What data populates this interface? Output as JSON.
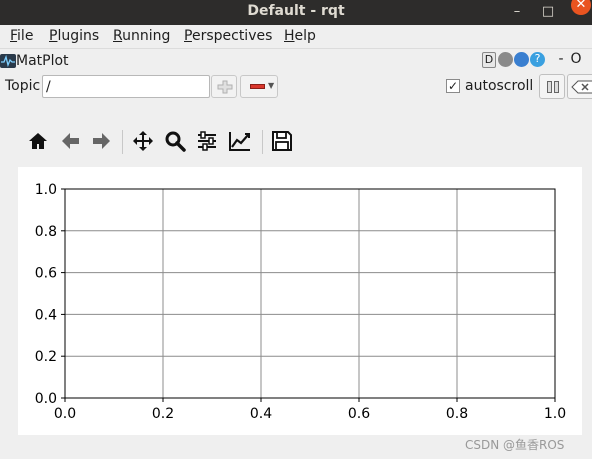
{
  "window": {
    "title": "Default - rqt",
    "minimize": "–",
    "maximize": "□",
    "close": "✕"
  },
  "menu": [
    {
      "u": "F",
      "rest": "ile"
    },
    {
      "u": "P",
      "rest": "lugins"
    },
    {
      "u": "R",
      "rest": "unning"
    },
    {
      "u": "P",
      "rest": "erspectives"
    },
    {
      "u": "H",
      "rest": "elp"
    }
  ],
  "plugin": {
    "name": "MatPlot",
    "buttons": {
      "d": "D",
      "dash": "-",
      "o": "O"
    }
  },
  "topic": {
    "label": "Topic",
    "value": "/"
  },
  "autoscroll": {
    "label": "autoscroll",
    "checked": true,
    "check_glyph": "✓"
  },
  "toolbar_icons": [
    "home-icon",
    "back-arrow-icon",
    "forward-arrow-icon",
    "pan-icon",
    "zoom-icon",
    "subplots-icon",
    "edit-axis-icon",
    "save-icon"
  ],
  "chart_data": {
    "type": "line",
    "series": [],
    "xlim": [
      0.0,
      1.0
    ],
    "ylim": [
      0.0,
      1.0
    ],
    "xticks": [
      "0.0",
      "0.2",
      "0.4",
      "0.6",
      "0.8",
      "1.0"
    ],
    "yticks": [
      "0.0",
      "0.2",
      "0.4",
      "0.6",
      "0.8",
      "1.0"
    ],
    "grid": true,
    "title": "",
    "xlabel": "",
    "ylabel": ""
  },
  "watermark": "CSDN @鱼香ROS"
}
